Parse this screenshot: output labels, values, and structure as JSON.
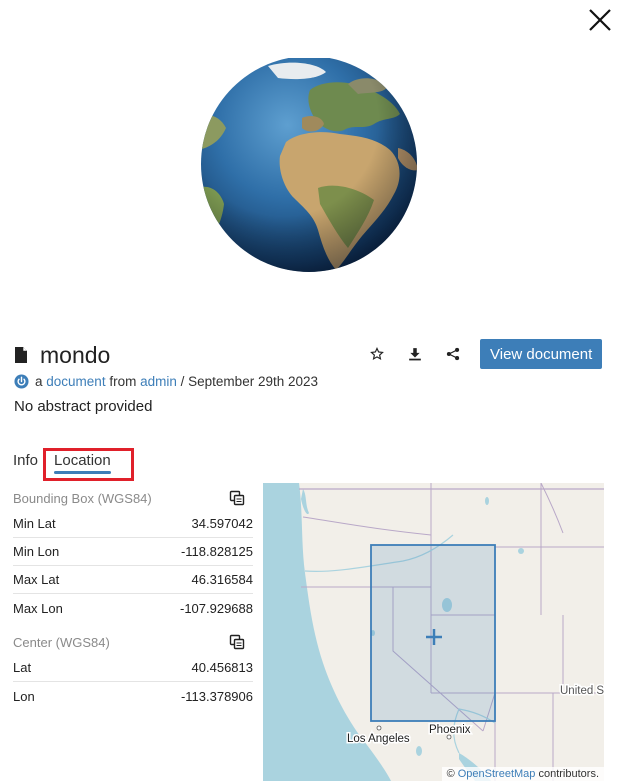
{
  "document": {
    "title": "mondo",
    "meta_prefix": "a",
    "meta_type": "document",
    "meta_from": "from",
    "meta_owner": "admin",
    "meta_date": "/ September 29th 2023",
    "abstract": "No abstract provided"
  },
  "actions": {
    "view_label": "View document",
    "icons": [
      "star-icon",
      "download-icon",
      "share-icon"
    ]
  },
  "tabs": [
    {
      "label": "Info"
    },
    {
      "label": "Location"
    }
  ],
  "bbox": {
    "header": "Bounding Box (WGS84)",
    "rows": [
      {
        "label": "Min Lat",
        "value": "34.597042"
      },
      {
        "label": "Min Lon",
        "value": "-118.828125"
      },
      {
        "label": "Max Lat",
        "value": "46.316584"
      },
      {
        "label": "Max Lon",
        "value": "-107.929688"
      }
    ]
  },
  "center": {
    "header": "Center (WGS84)",
    "rows": [
      {
        "label": "Lat",
        "value": "40.456813"
      },
      {
        "label": "Lon",
        "value": "-113.378906"
      }
    ]
  },
  "map": {
    "labels": {
      "los_angeles": "Los Angeles",
      "phoenix": "Phoenix",
      "united_states": "United S"
    },
    "attribution_prefix": "©",
    "attribution_link": "OpenStreetMap",
    "attribution_suffix": "contributors."
  },
  "colors": {
    "accent": "#3d7eb8",
    "highlight": "#e0202a",
    "map_land": "#f2efe9",
    "map_water": "#aad3df"
  }
}
